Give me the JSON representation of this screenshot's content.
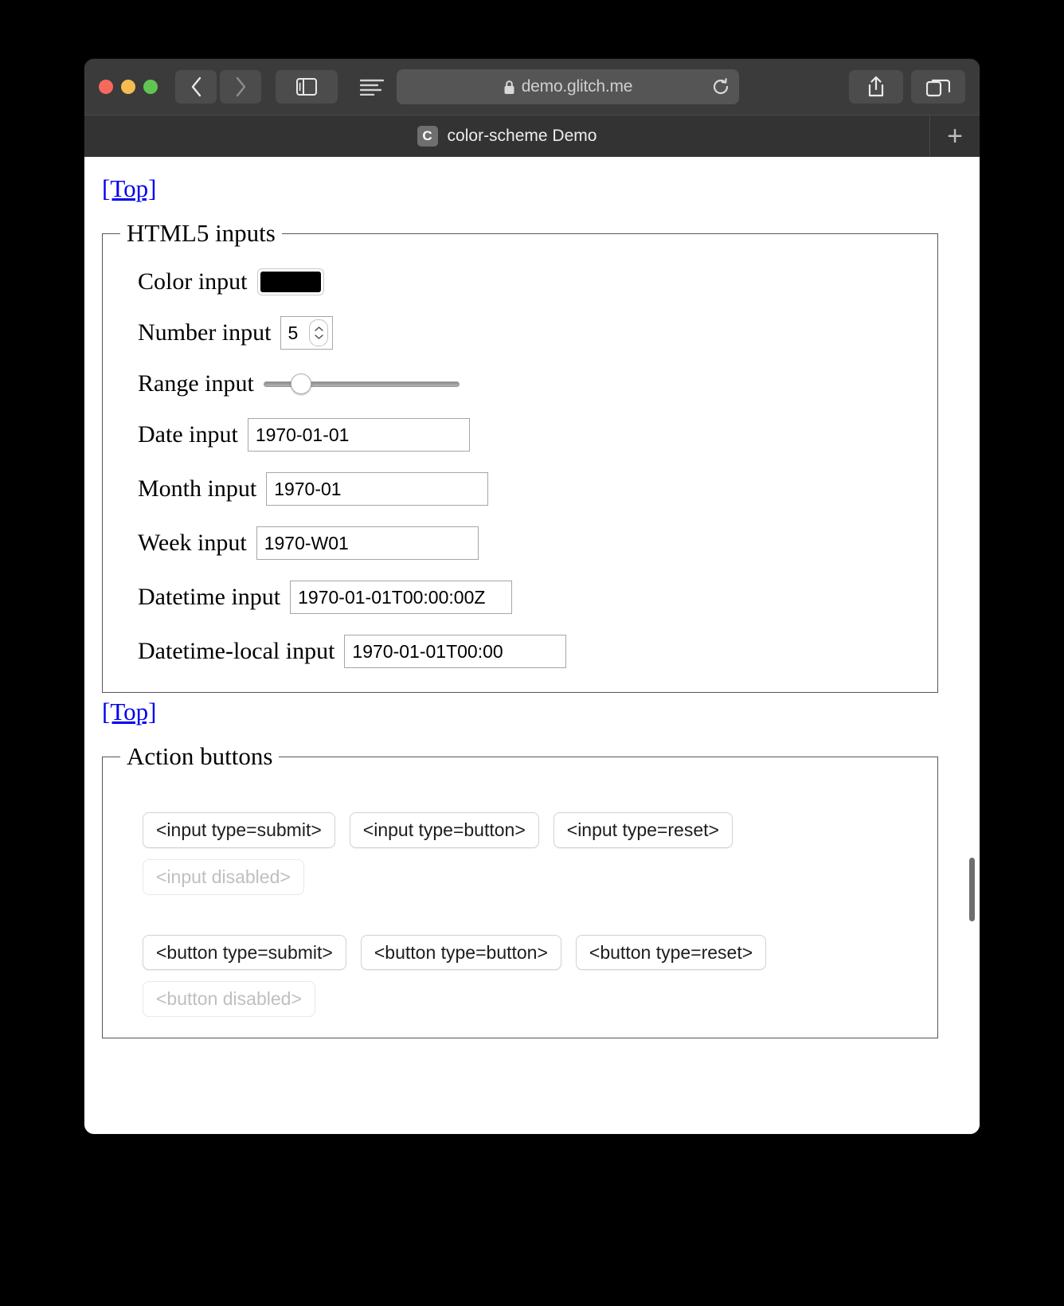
{
  "browser": {
    "traffic_lights": [
      "close",
      "minimize",
      "maximize"
    ],
    "back_icon": "chevron-left-icon",
    "forward_icon": "chevron-right-icon",
    "sidebar_icon": "sidebar-icon",
    "reader_icon": "reader-view-icon",
    "lock_icon": "lock-icon",
    "url": "demo.glitch.me",
    "reload_icon": "reload-icon",
    "share_icon": "share-icon",
    "tabs_overview_icon": "tabs-overview-icon",
    "tab": {
      "favicon_letter": "C",
      "title": "color-scheme Demo"
    },
    "new_tab_label": "+"
  },
  "page": {
    "top_link_1": "[Top]",
    "top_link_2": "[Top]",
    "html5_inputs": {
      "legend": "HTML5 inputs",
      "rows": [
        {
          "label": "Color input",
          "type": "color",
          "value": "#000000"
        },
        {
          "label": "Number input",
          "type": "number",
          "value": "5"
        },
        {
          "label": "Range input",
          "type": "range",
          "value": "14"
        },
        {
          "label": "Date input",
          "type": "text",
          "value": "1970-01-01"
        },
        {
          "label": "Month input",
          "type": "text",
          "value": "1970-01"
        },
        {
          "label": "Week input",
          "type": "text",
          "value": "1970-W01"
        },
        {
          "label": "Datetime input",
          "type": "text",
          "value": "1970-01-01T00:00:00Z"
        },
        {
          "label": "Datetime-local input",
          "type": "text",
          "value": "1970-01-01T00:00"
        }
      ]
    },
    "action_buttons": {
      "legend": "Action buttons",
      "input_row": [
        "<input type=submit>",
        "<input type=button>",
        "<input type=reset>"
      ],
      "input_disabled": "<input disabled>",
      "button_row": [
        "<button type=submit>",
        "<button type=button>",
        "<button type=reset>"
      ],
      "button_disabled": "<button disabled>"
    }
  },
  "colors": {
    "link": "#0000ee",
    "color_swatch": "#000000",
    "toolbar_bg": "#3b3b3b",
    "page_bg": "#ffffff"
  }
}
